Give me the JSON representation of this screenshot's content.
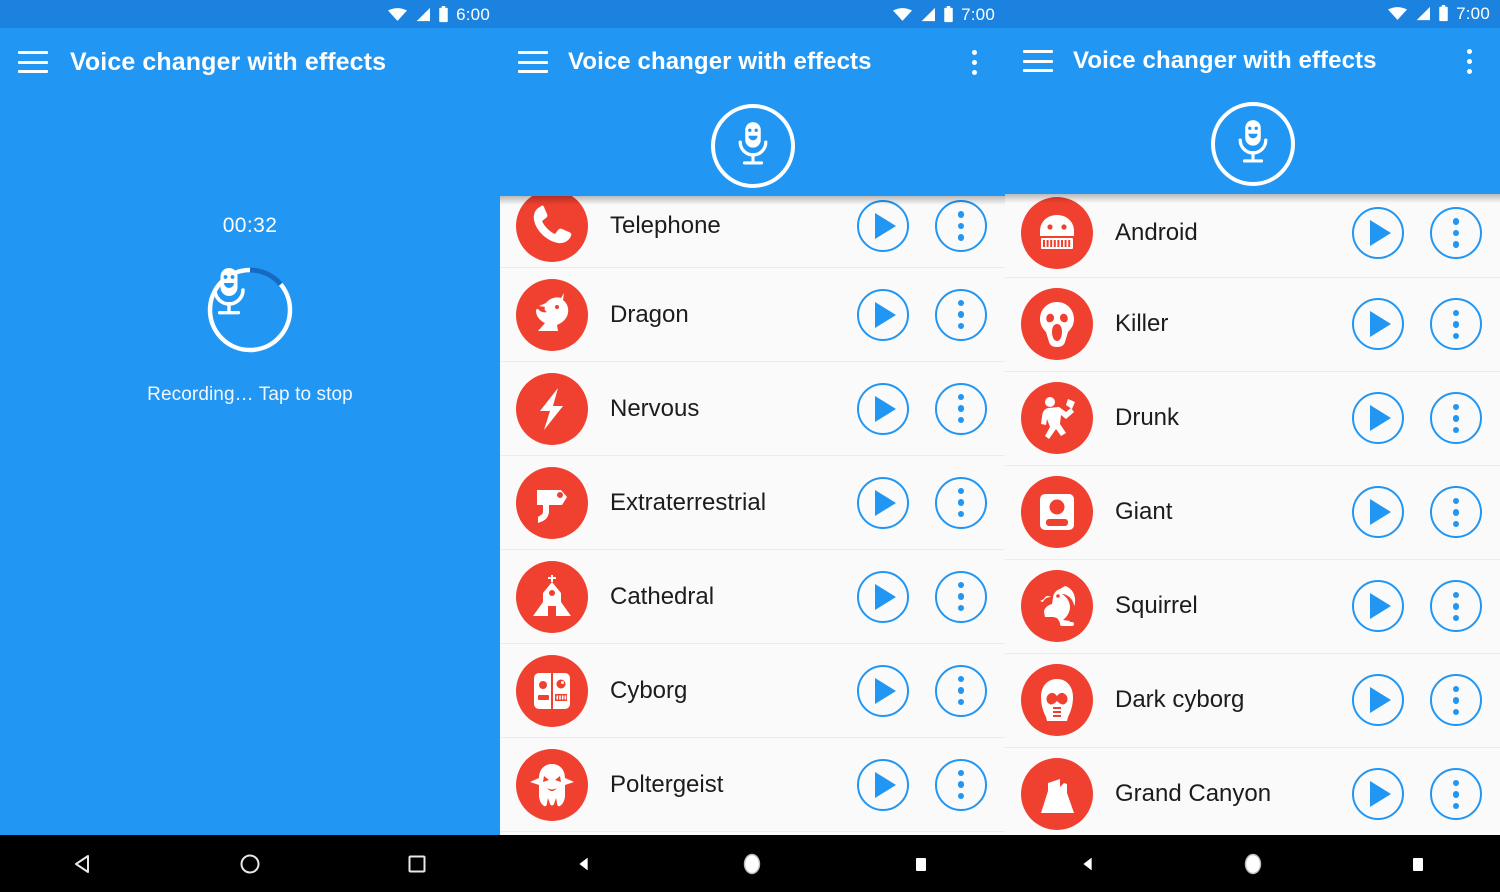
{
  "app": {
    "title": "Voice changer with effects",
    "accent_blue": "#2196f3",
    "statusbar_blue": "#1b82e0",
    "avatar_red": "#f0402f",
    "list_bg": "#fafafa"
  },
  "panels": [
    {
      "id": "recording-screen",
      "statusbar": {
        "time": "6:00",
        "wifi_icon": "wifi-icon",
        "signal_icon": "signal-icon",
        "battery_icon": "battery-icon"
      },
      "appbar": {
        "menu_icon": "hamburger-menu-icon",
        "title": "Voice changer with effects",
        "has_overflow": false
      },
      "recording": {
        "timer": "00:32",
        "mic_icon": "microphone-smiley-icon",
        "hint": "Recording… Tap to stop",
        "progress_percent": 11
      },
      "navbar": {
        "back": "back-triangle-icon",
        "home": "home-circle-icon",
        "recents": "recents-square-icon",
        "style": "outline"
      }
    },
    {
      "id": "effects-list-screen-left",
      "statusbar": {
        "time": "7:00",
        "wifi_icon": "wifi-icon",
        "signal_icon": "signal-icon",
        "battery_icon": "battery-icon"
      },
      "appbar": {
        "menu_icon": "hamburger-menu-icon",
        "title": "Voice changer with effects",
        "overflow_icon": "overflow-menu-icon",
        "has_overflow": true
      },
      "fab": {
        "icon": "microphone-smiley-icon"
      },
      "list": [
        {
          "label": "Telephone",
          "icon": "telephone-handset-icon",
          "play": "play-icon",
          "menu": "overflow-menu-icon"
        },
        {
          "label": "Dragon",
          "icon": "dragon-head-icon",
          "play": "play-icon",
          "menu": "overflow-menu-icon"
        },
        {
          "label": "Nervous",
          "icon": "lightning-bolt-icon",
          "play": "play-icon",
          "menu": "overflow-menu-icon"
        },
        {
          "label": "Extraterrestrial",
          "icon": "ray-gun-icon",
          "play": "play-icon",
          "menu": "overflow-menu-icon"
        },
        {
          "label": "Cathedral",
          "icon": "church-icon",
          "play": "play-icon",
          "menu": "overflow-menu-icon"
        },
        {
          "label": "Cyborg",
          "icon": "cyborg-face-icon",
          "play": "play-icon",
          "menu": "overflow-menu-icon"
        },
        {
          "label": "Poltergeist",
          "icon": "ghost-icon",
          "play": "play-icon",
          "menu": "overflow-menu-icon"
        }
      ],
      "navbar": {
        "back": "back-triangle-icon",
        "home": "home-circle-icon",
        "recents": "recents-square-icon",
        "style": "filled"
      }
    },
    {
      "id": "effects-list-screen-right",
      "statusbar": {
        "time": "7:00",
        "wifi_icon": "wifi-icon",
        "signal_icon": "signal-icon",
        "battery_icon": "battery-icon"
      },
      "appbar": {
        "menu_icon": "hamburger-menu-icon",
        "title": "Voice changer with effects",
        "overflow_icon": "overflow-menu-icon",
        "has_overflow": true
      },
      "fab": {
        "icon": "microphone-smiley-icon"
      },
      "list": [
        {
          "label": "Android",
          "icon": "android-robot-face-icon",
          "play": "play-icon",
          "menu": "overflow-menu-icon"
        },
        {
          "label": "Killer",
          "icon": "scream-mask-icon",
          "play": "play-icon",
          "menu": "overflow-menu-icon"
        },
        {
          "label": "Drunk",
          "icon": "dancing-person-icon",
          "play": "play-icon",
          "menu": "overflow-menu-icon"
        },
        {
          "label": "Giant",
          "icon": "giant-bust-icon",
          "play": "play-icon",
          "menu": "overflow-menu-icon"
        },
        {
          "label": "Squirrel",
          "icon": "squirrel-icon",
          "play": "play-icon",
          "menu": "overflow-menu-icon"
        },
        {
          "label": "Dark cyborg",
          "icon": "dark-helmet-icon",
          "play": "play-icon",
          "menu": "overflow-menu-icon"
        },
        {
          "label": "Grand Canyon",
          "icon": "canyon-mesa-icon",
          "play": "play-icon",
          "menu": "overflow-menu-icon"
        }
      ],
      "navbar": {
        "back": "back-triangle-icon",
        "home": "home-circle-icon",
        "recents": "recents-square-icon",
        "style": "filled"
      }
    }
  ]
}
